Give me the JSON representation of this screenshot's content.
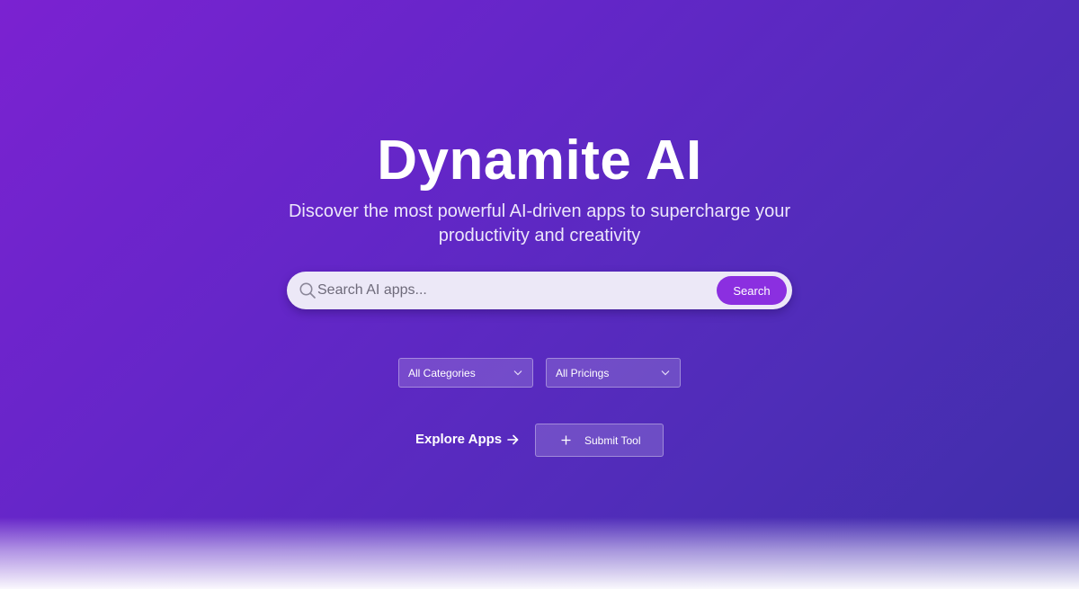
{
  "hero": {
    "title": "Dynamite AI",
    "subtitle": "Discover the most powerful AI-driven apps to supercharge your productivity and creativity"
  },
  "search": {
    "placeholder": "Search AI apps...",
    "value": "",
    "button_label": "Search",
    "icon": "search-icon"
  },
  "filters": {
    "categories": {
      "selected": "All Categories",
      "icon": "chevron-down-icon"
    },
    "pricings": {
      "selected": "All Pricings",
      "icon": "chevron-down-icon"
    }
  },
  "actions": {
    "explore_label": "Explore Apps",
    "explore_icon": "arrow-right-icon",
    "submit_label": "Submit Tool",
    "submit_icon": "plus-icon"
  },
  "colors": {
    "background_start": "#7b22d1",
    "background_end": "#3d2ea8",
    "accent": "#8b2fe0",
    "search_bg": "#ece8f7"
  }
}
